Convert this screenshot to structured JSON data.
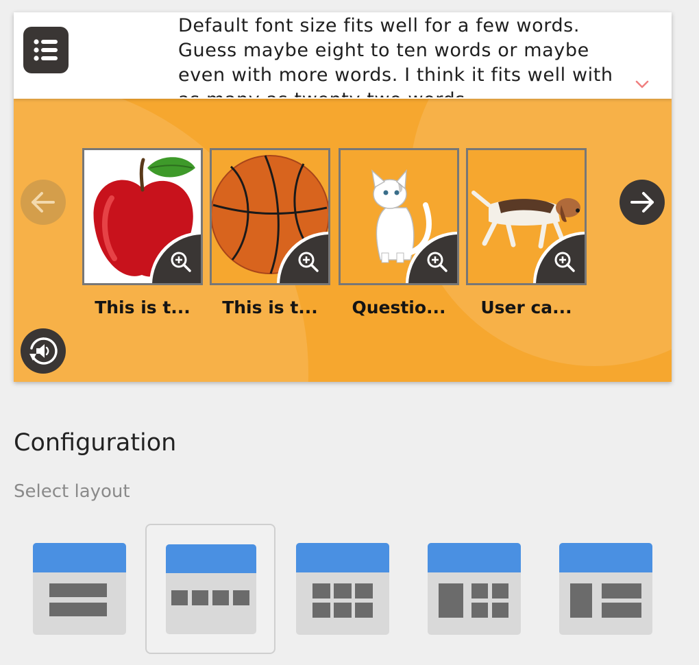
{
  "question": {
    "text": "Default font size fits well for a few words. Guess maybe eight to ten words or maybe even with more words. I think it fits well with as many as twenty two words."
  },
  "icons": {
    "menu": "list-icon",
    "expand": "chevron-down-icon",
    "prev": "arrow-left-icon",
    "next": "arrow-right-icon",
    "audio": "replay-audio-icon",
    "zoom": "zoom-in-icon"
  },
  "colors": {
    "stage": "#f6a72f",
    "dark": "#3a3634",
    "accent_chevron": "#f08080",
    "layout_header": "#4a90e2"
  },
  "choices": [
    {
      "label": "This is t...",
      "image": "apple"
    },
    {
      "label": "This is t...",
      "image": "basketball"
    },
    {
      "label": "Questio...",
      "image": "cat"
    },
    {
      "label": "User ca...",
      "image": "dog"
    }
  ],
  "configuration": {
    "title": "Configuration",
    "select_layout_label": "Select layout",
    "layouts": [
      {
        "name": "two-rows",
        "selected": false
      },
      {
        "name": "four-in-row",
        "selected": true
      },
      {
        "name": "grid-2x3",
        "selected": false
      },
      {
        "name": "tall-plus-grid",
        "selected": false
      },
      {
        "name": "tall-plus-rows",
        "selected": false
      }
    ]
  }
}
